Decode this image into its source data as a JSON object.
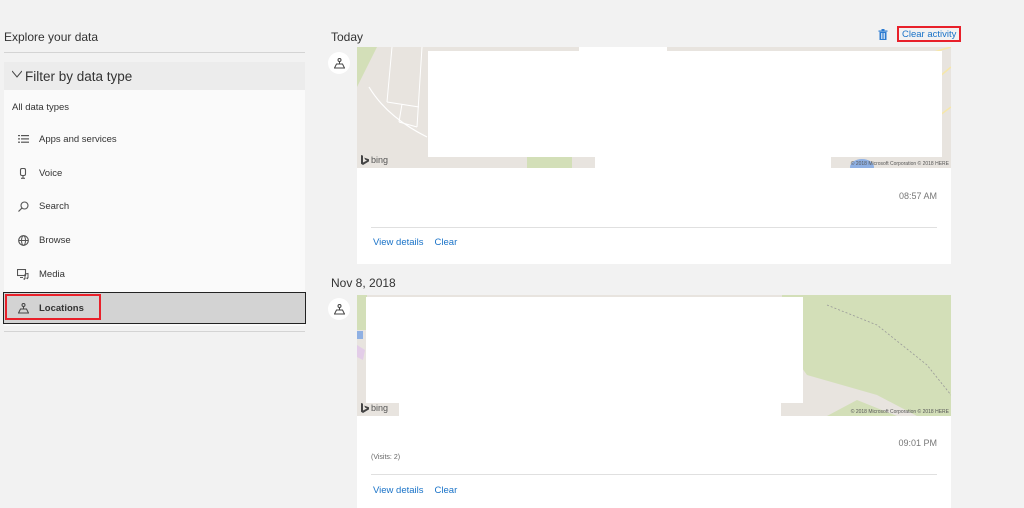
{
  "sidebar": {
    "title": "Explore your data",
    "filter_header": "Filter by data type",
    "all_types_label": "All data types",
    "items": [
      {
        "label": "Apps and services",
        "icon": "list-icon"
      },
      {
        "label": "Voice",
        "icon": "microphone-icon"
      },
      {
        "label": "Search",
        "icon": "search-icon"
      },
      {
        "label": "Browse",
        "icon": "globe-icon"
      },
      {
        "label": "Media",
        "icon": "media-icon"
      },
      {
        "label": "Locations",
        "icon": "location-icon",
        "selected": true
      }
    ]
  },
  "toolbar": {
    "clear_activity_label": "Clear activity",
    "clear_activity_icon": "trash-icon"
  },
  "groups": [
    {
      "date": "Today",
      "entry": {
        "map_brand": "bing",
        "copyright": "© 2018 Microsoft Corporation © 2018 HERE",
        "time": "08:57 AM",
        "visits": "",
        "view_details_label": "View details",
        "clear_label": "Clear"
      }
    },
    {
      "date": "Nov 8, 2018",
      "entry": {
        "map_brand": "bing",
        "copyright": "© 2018 Microsoft Corporation © 2018 HERE",
        "time": "09:01 PM",
        "visits": "(Visits: 2)",
        "view_details_label": "View details",
        "clear_label": "Clear"
      }
    }
  ],
  "colors": {
    "accent_link": "#1a73c8",
    "highlight_red": "#e8202a",
    "map_land": "#e8e4df",
    "map_park": "#d3dfb8"
  }
}
